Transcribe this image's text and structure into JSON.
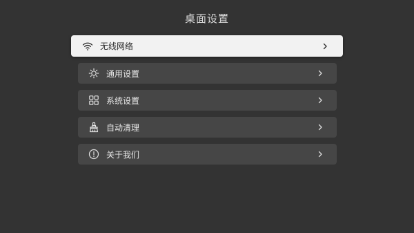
{
  "page": {
    "title": "桌面设置"
  },
  "menu": {
    "items": [
      {
        "label": "无线网络",
        "icon": "wifi-icon",
        "focused": true
      },
      {
        "label": "通用设置",
        "icon": "sun-icon",
        "focused": false
      },
      {
        "label": "系统设置",
        "icon": "grid-icon",
        "focused": false
      },
      {
        "label": "自动清理",
        "icon": "broom-icon",
        "focused": false
      },
      {
        "label": "关于我们",
        "icon": "info-icon",
        "focused": false
      }
    ]
  },
  "colors": {
    "background": "#333333",
    "item_background": "#464646",
    "focused_background": "#f2f2f2",
    "text": "#e8e8e8",
    "focused_text": "#2a2a2a"
  }
}
